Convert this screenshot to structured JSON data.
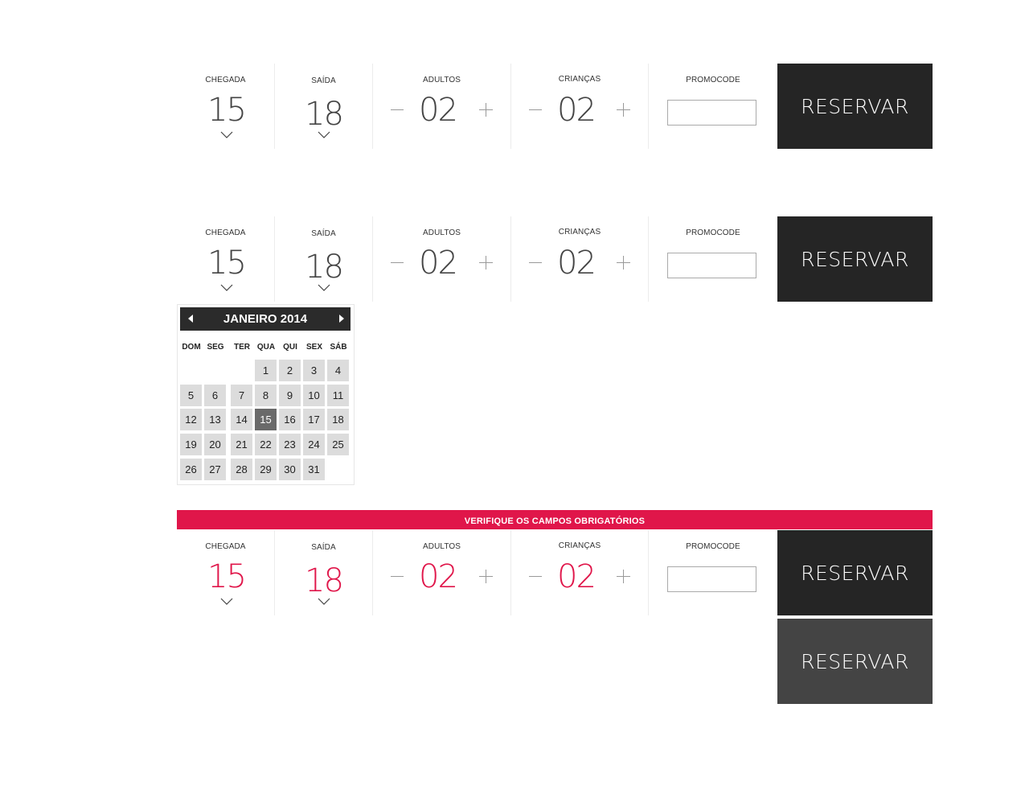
{
  "labels": {
    "arrival": "CHEGADA",
    "departure": "SAÍDA",
    "adults": "ADULTOS",
    "children": "CRIANÇAS",
    "promocode": "PROMOCODE"
  },
  "values": {
    "arrival_day": "15",
    "departure_day": "18",
    "adults": "02",
    "children": "02",
    "promocode": ""
  },
  "button_label": "RESERVAR",
  "calendar": {
    "title": "JANEIRO 2014",
    "weekdays": [
      "DOM",
      "SEG",
      "TER",
      "QUA",
      "QUI",
      "SEX",
      "SÁB"
    ],
    "first_weekday_index": 3,
    "days_in_month": 31,
    "selected_day": 15
  },
  "alert_text": "VERIFIQUE OS CAMPOS OBRIGATÓRIOS",
  "colors": {
    "error": "#e0164a",
    "button": "#252525",
    "button_hover": "#444444",
    "selected_day": "#6a6a6a",
    "day_bg": "#dcdcdc"
  },
  "icons": [
    "chevron-down-icon",
    "minus-icon",
    "plus-icon",
    "arrow-left-icon",
    "arrow-right-icon"
  ]
}
